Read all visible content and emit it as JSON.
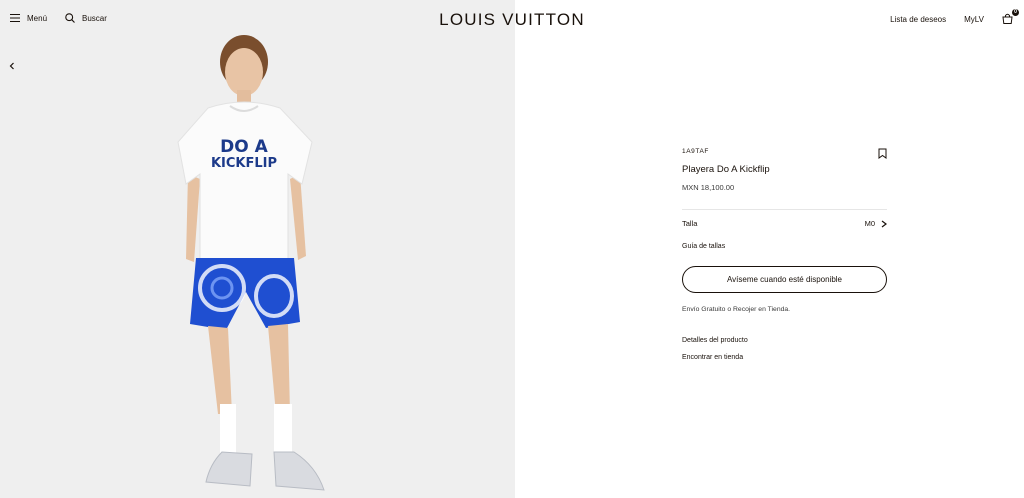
{
  "header": {
    "menu_label": "Menú",
    "search_label": "Buscar",
    "logo": "LOUIS VUITTON",
    "wishlist_label": "Lista de deseos",
    "account_label": "MyLV",
    "bag_count": "0"
  },
  "product": {
    "image_print_line1": "DO A",
    "image_print_line2": "KICKFLIP",
    "sku": "1A9TAF",
    "name": "Playera Do A Kickflip",
    "price": "MXN 18,100.00",
    "size_label": "Talla",
    "size_value": "M0",
    "size_guide": "Guía de tallas",
    "notify_button": "Avíseme cuando esté disponible",
    "shipping_note": "Envío Gratuito o Recojer en Tienda.",
    "details_link": "Detalles del producto",
    "store_link": "Encontrar en tienda"
  },
  "colors": {
    "text": "#19110b",
    "image_bg": "#efefef",
    "shorts_blue": "#1f4fd1"
  }
}
